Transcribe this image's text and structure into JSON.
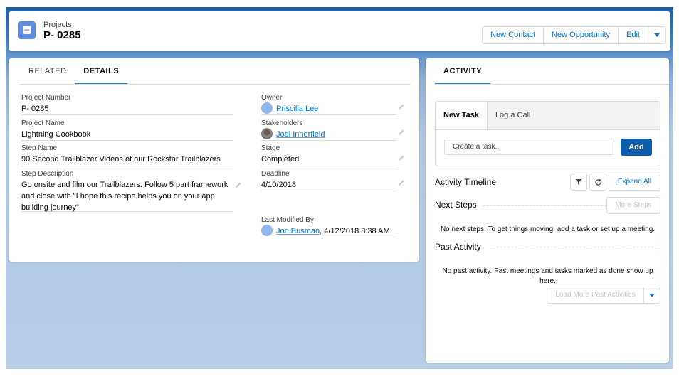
{
  "header": {
    "object_name": "Projects",
    "record_title": "P- 0285",
    "icon": "project-icon",
    "actions": [
      "New Contact",
      "New Opportunity",
      "Edit"
    ]
  },
  "detail_tabs": [
    "RELATED",
    "DETAILS"
  ],
  "fields_left": [
    {
      "label": "Project Number",
      "value": "P- 0285"
    },
    {
      "label": "Project Name",
      "value": "Lightning Cookbook"
    },
    {
      "label": "Step Name",
      "value": "90 Second Trailblazer Videos of our Rockstar Trailblazers"
    },
    {
      "label": "Step Description",
      "value_lines": [
        "Go onsite and film our Trailblazers. Follow 5 part framework",
        "and close with \"I hope this recipe helps you on your app",
        "building journey\""
      ]
    }
  ],
  "fields_right": [
    {
      "label": "Owner",
      "value": "Priscilla Lee"
    },
    {
      "label": "Stakeholders",
      "value": "Jodi Innerfield"
    },
    {
      "label": "Stage",
      "value": "Completed"
    },
    {
      "label": "Deadline",
      "value": "4/10/2018"
    },
    {
      "label": "Last Modified By",
      "value": "Jon Busman",
      "suffix": ", 4/12/2018 8:38 AM"
    }
  ],
  "activity": {
    "tab": "ACTIVITY",
    "composer_tabs": [
      "New Task",
      "Log a Call"
    ],
    "task_placeholder": "Create a task...",
    "add_label": "Add",
    "timeline_title": "Activity Timeline",
    "expand_all": "Expand All",
    "next_steps_title": "Next Steps",
    "more_steps": "More Steps",
    "next_steps_empty": "No next steps. To get things moving, add a task or set up a meeting.",
    "past_activity_title": "Past Activity",
    "past_empty_lines": [
      "No past activity. Past meetings and tasks marked as done show up",
      "here."
    ],
    "load_more": "Load More Past Activities"
  },
  "colors": {
    "brand": "#0070d2",
    "add_button": "#0b5cab",
    "header_icon": "#5d8ce0"
  }
}
